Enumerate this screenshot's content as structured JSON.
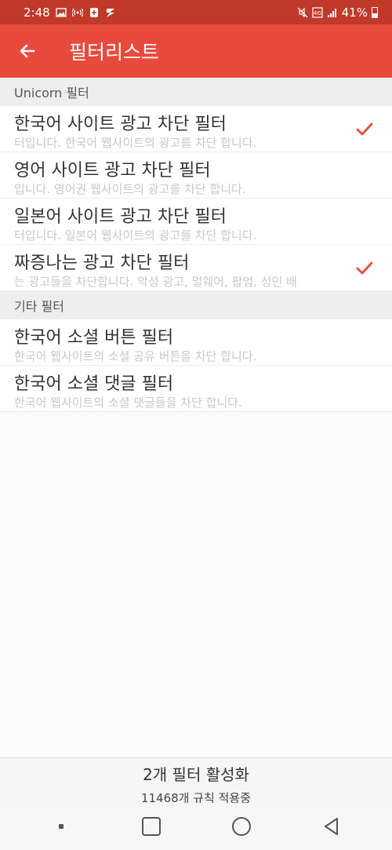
{
  "status_bar": {
    "time": "2:48",
    "battery": "41%"
  },
  "app_bar": {
    "title": "필터리스트",
    "back_icon": "arrow-left-icon"
  },
  "sections": [
    {
      "header": "Unicorn 필터",
      "items": [
        {
          "name": "한국어 사이트 광고 차단 필터",
          "desc": "터입니다. 한국어 웹사이트의 광고를 차단 합니다.",
          "checked": true
        },
        {
          "name": "영어 사이트 광고 차단 필터",
          "desc": "입니다. 영어권 웹사이트의 광고를 차단 합니다.",
          "checked": false
        },
        {
          "name": "일본어 사이트 광고 차단 필터",
          "desc": "터입니다. 일본어 웹사이트의 광고를 차단 합니다.",
          "checked": false
        },
        {
          "name": "짜증나는 광고 차단 필터",
          "desc": "는 광고들을 차단합니다. 악성 광고, 멀웨어, 팝업, 성인 배",
          "checked": true
        }
      ]
    },
    {
      "header": "기타 필터",
      "items": [
        {
          "name": "한국어 소셜 버튼 필터",
          "desc": "한국어 웹사이트의 소셜 공유 버튼을 차단 합니다.",
          "checked": false
        },
        {
          "name": "한국어 소셜 댓글 필터",
          "desc": "한국어 웹사이트의 소셜 댓글들을 차단 합니다.",
          "checked": false
        }
      ]
    }
  ],
  "footer": {
    "active_count": "2개 필터 활성화",
    "rules_count": "11468개 규칙 적용중"
  },
  "colors": {
    "accent": "#e84a3c",
    "status_bar": "#c0392b",
    "check": "#e84a3c"
  },
  "nav_icons": [
    "recent-apps-dot-icon",
    "square-home-icon",
    "circle-home-icon",
    "triangle-back-icon"
  ]
}
